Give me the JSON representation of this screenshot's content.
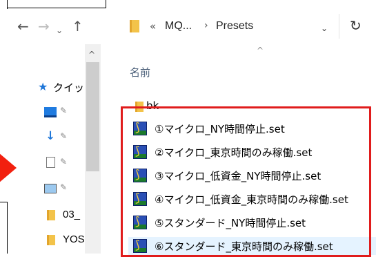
{
  "address": {
    "overflow_chevron": "«",
    "crumb1": "MQ...",
    "separator": "›",
    "crumb2": "Presets"
  },
  "nav": {
    "back": "←",
    "forward": "→",
    "recent": "⌄",
    "up": "↑",
    "dropdown": "⌄",
    "refresh": "↻"
  },
  "navpane": {
    "quick_access_label": "クイッ",
    "pin_glyph": "✧",
    "items": [
      {
        "label": "03_"
      },
      {
        "label": "YOS"
      }
    ],
    "scroll_up": "^"
  },
  "list": {
    "sort_indicator": "^",
    "column_name": "名前",
    "folder": "bk",
    "files": [
      "①マイクロ_NY時間停止.set",
      "②マイクロ_東京時間のみ稼働.set",
      "③マイクロ_低資金_NY時間停止.set",
      "④マイクロ_低資金_東京時間のみ稼働.set",
      "⑤スタンダード_NY時間停止.set",
      "⑥スタンダード_東京時間のみ稼働.set"
    ],
    "highlighted_index": 5
  },
  "colors": {
    "highlight_frame": "#e01c1c",
    "arrow": "#f2200f",
    "selection": "#e5f3ff"
  }
}
